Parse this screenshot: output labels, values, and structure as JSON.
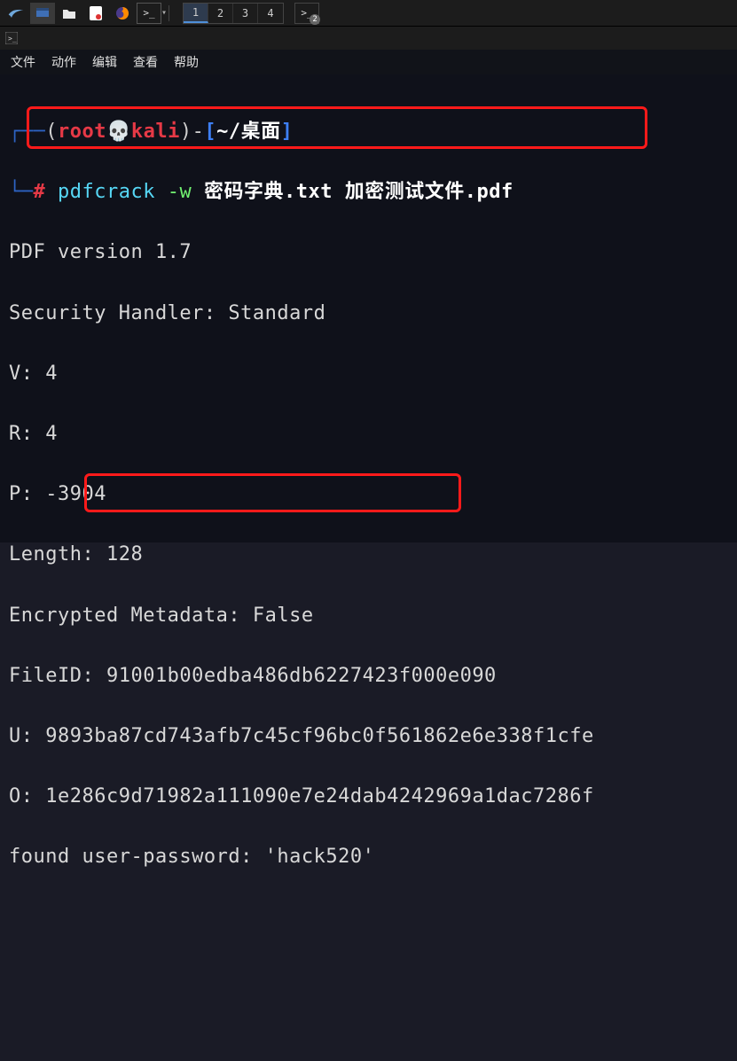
{
  "taskbar": {
    "workspaces": [
      "1",
      "2",
      "3",
      "4"
    ],
    "active_workspace": 0,
    "badge_count": "2"
  },
  "menubar": {
    "file": "文件",
    "action": "动作",
    "edit": "编辑",
    "view": "查看",
    "help": "帮助"
  },
  "prompt": {
    "corner_top": "┌──",
    "lparen": "(",
    "user": "root",
    "skull": "💀",
    "host": "kali",
    "rparen": ")",
    "dash": "-",
    "lbrack": "[",
    "cwd": "~/桌面",
    "rbrack": "]",
    "corner_bot": "└─",
    "hash": "#",
    "cmd_name": "pdfcrack",
    "flag": "-w",
    "arg1": "密码字典.txt",
    "arg2": "加密测试文件.pdf"
  },
  "output": {
    "l1": "PDF version 1.7",
    "l2": "Security Handler: Standard",
    "l3": "V: 4",
    "l4": "R: 4",
    "l5": "P: -3904",
    "l6": "Length: 128",
    "l7": "Encrypted Metadata: False",
    "l8": "FileID: 91001b00edba486db6227423f000e090",
    "l9": "U: 9893ba87cd743afb7c45cf96bc0f561862e6e338f1cfe",
    "l10": "O: 1e286c9d71982a111090e7e24dab4242969a1dac7286f",
    "l11": "found user-password: 'hack520'"
  }
}
